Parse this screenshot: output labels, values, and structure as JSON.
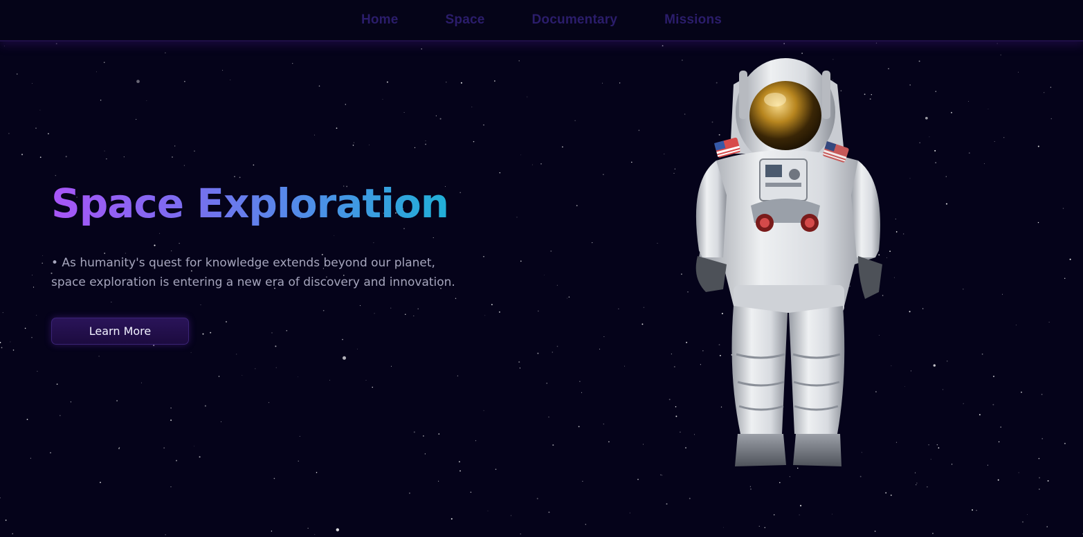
{
  "nav": {
    "items": [
      {
        "label": "Home"
      },
      {
        "label": "Space"
      },
      {
        "label": "Documentary"
      },
      {
        "label": "Missions"
      }
    ]
  },
  "hero": {
    "title": "Space Exploration",
    "description": "• As humanity's quest for knowledge extends beyond our planet, space exploration is entering a new era of discovery and innovation.",
    "button_label": "Learn More"
  },
  "icons": {
    "hero_image": "astronaut-illustration"
  },
  "colors": {
    "background": "#05031a",
    "nav_text": "#2b1d6b",
    "title_gradient_start": "#a855f7",
    "title_gradient_end": "#16b7d3",
    "button_bg": "#2a1459"
  }
}
